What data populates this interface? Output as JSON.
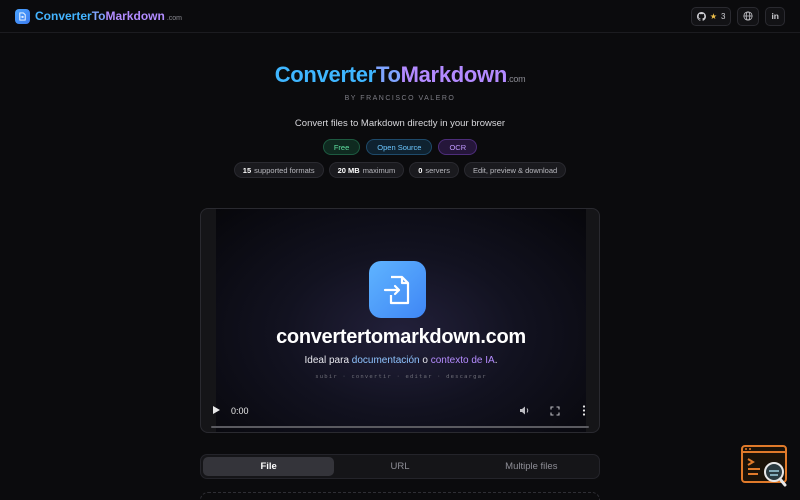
{
  "header": {
    "brand_part1": "Converter",
    "brand_part2": "To",
    "brand_part3": "Markdown",
    "brand_suffix": ".com",
    "github_stars": "3",
    "github_icon": "github-icon",
    "language_icon": "globe-icon",
    "linkedin_label": "in"
  },
  "hero": {
    "title_part1": "Converter",
    "title_part2": "To",
    "title_part3": "Markdown",
    "title_suffix": ".com",
    "byline": "BY FRANCISCO VALERO",
    "tagline": "Convert files to Markdown directly in your browser",
    "badges": [
      "Free",
      "Open Source",
      "OCR"
    ],
    "stats": [
      {
        "value": "15",
        "label": "supported formats"
      },
      {
        "value": "20 MB",
        "label": "maximum"
      },
      {
        "value": "0",
        "label": "servers"
      },
      {
        "value": "",
        "label": "Edit, preview & download"
      }
    ]
  },
  "video": {
    "domain": "convertertomarkdown.com",
    "sub_a": "Ideal para ",
    "sub_b": "documentación",
    "sub_c": " o ",
    "sub_d": "contexto de IA",
    "sub_e": ".",
    "steps": "subir · convertir · editar · descargar",
    "time": "0:00",
    "progress": 0
  },
  "tabs": [
    {
      "label": "File",
      "active": true
    },
    {
      "label": "URL",
      "active": false
    },
    {
      "label": "Multiple files",
      "active": false
    }
  ],
  "colors": {
    "accent_blue": "#3fb6ff",
    "accent_purple": "#b38aff",
    "background": "#0b0b0d"
  }
}
